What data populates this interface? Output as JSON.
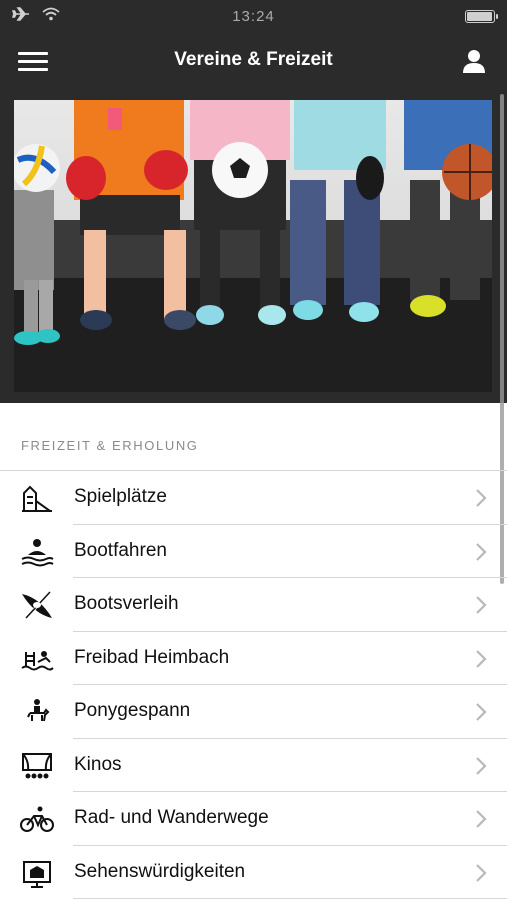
{
  "status_bar": {
    "time": "13:24",
    "battery_level": 0.95
  },
  "nav": {
    "title": "Vereine & Freizeit",
    "menu_icon": "hamburger-menu-icon",
    "profile_icon": "user-profile-icon"
  },
  "section": {
    "header": "FREIZEIT & ERHOLUNG"
  },
  "list": {
    "items": [
      {
        "label": "Spielplätze",
        "icon": "playground-icon"
      },
      {
        "label": "Bootfahren",
        "icon": "boating-icon"
      },
      {
        "label": "Bootsverleih",
        "icon": "kayak-icon"
      },
      {
        "label": "Freibad Heimbach",
        "icon": "pool-icon"
      },
      {
        "label": "Ponygespann",
        "icon": "pony-icon"
      },
      {
        "label": "Kinos",
        "icon": "cinema-icon"
      },
      {
        "label": "Rad- und Wanderwege",
        "icon": "bicycle-icon"
      },
      {
        "label": "Sehenswürdigkeiten",
        "icon": "sightseeing-icon"
      }
    ]
  },
  "colors": {
    "bar_bg": "#2b2b2b",
    "separator": "#d6d6d8",
    "section_text": "#8a8a8f"
  }
}
